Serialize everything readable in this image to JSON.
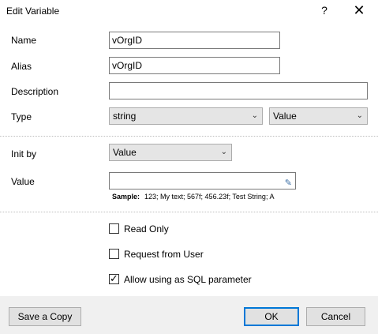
{
  "dialog": {
    "title": "Edit Variable",
    "help_glyph": "?",
    "close_glyph": "✕"
  },
  "form": {
    "name_label": "Name",
    "name_value": "vOrgID",
    "alias_label": "Alias",
    "alias_value": "vOrgID",
    "description_label": "Description",
    "description_value": "",
    "type_label": "Type",
    "type_value": "string",
    "type_mode_value": "Value",
    "init_by_label": "Init by",
    "init_by_value": "Value",
    "value_label": "Value",
    "value_value": "",
    "sample_label": "Sample:",
    "sample_text": "123; My text; 567f; 456.23f; Test String; A"
  },
  "options": {
    "read_only_label": "Read Only",
    "read_only_checked": false,
    "request_from_user_label": "Request from User",
    "request_from_user_checked": false,
    "allow_sql_label": "Allow using as SQL parameter",
    "allow_sql_checked": true
  },
  "buttons": {
    "save_copy": "Save a Copy",
    "ok": "OK",
    "cancel": "Cancel"
  },
  "icons": {
    "dropdown": "chevron-down-icon",
    "edit": "pencil-icon",
    "check": "checkmark-icon"
  }
}
